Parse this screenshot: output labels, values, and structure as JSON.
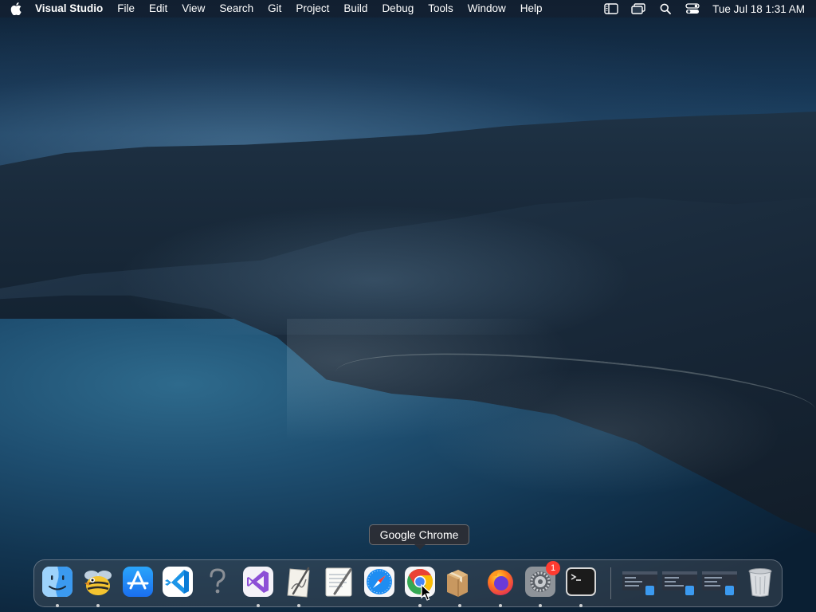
{
  "menubar": {
    "apple_icon": "apple-logo-icon",
    "app_name": "Visual Studio",
    "items": [
      "File",
      "Edit",
      "View",
      "Search",
      "Git",
      "Project",
      "Build",
      "Debug",
      "Tools",
      "Window",
      "Help"
    ],
    "status_icons": [
      "sidebar-icon",
      "window-switch-icon",
      "spotlight-search-icon",
      "control-center-icon"
    ],
    "clock": "Tue Jul 18  1:31 AM"
  },
  "tooltip": {
    "label": "Google Chrome"
  },
  "dock": {
    "badge_count": "1",
    "items": [
      {
        "icon": "finder-icon",
        "running": true
      },
      {
        "icon": "cyberduck-icon",
        "running": true
      },
      {
        "icon": "app-store-icon",
        "running": false
      },
      {
        "icon": "vscode-icon",
        "running": false
      },
      {
        "icon": "help-question-icon",
        "running": false
      },
      {
        "icon": "visual-studio-icon",
        "running": true
      },
      {
        "icon": "script-editor-icon",
        "running": true
      },
      {
        "icon": "textedit-icon",
        "running": false
      },
      {
        "icon": "safari-icon",
        "running": false
      },
      {
        "icon": "chrome-icon",
        "running": true
      },
      {
        "icon": "package-installer-icon",
        "running": true
      },
      {
        "icon": "firefox-icon",
        "running": true
      },
      {
        "icon": "system-settings-icon",
        "running": true
      },
      {
        "icon": "terminal-icon",
        "running": true
      },
      {
        "icon": "finder-window-icon",
        "running": false
      },
      {
        "icon": "finder-window-icon",
        "running": false
      },
      {
        "icon": "finder-window-icon",
        "running": false
      },
      {
        "icon": "trash-icon",
        "running": false
      }
    ]
  },
  "colors": {
    "menubar_text": "#ffffff",
    "badge": "#ff3b30",
    "chrome_red": "#ea4335",
    "chrome_yellow": "#fbbc05",
    "chrome_green": "#34a853",
    "chrome_blue": "#4285f4",
    "vscode_blue": "#0a7bd6",
    "appstore_blue": "#1a8cf8",
    "visual_studio_purple": "#8c4fd6"
  }
}
